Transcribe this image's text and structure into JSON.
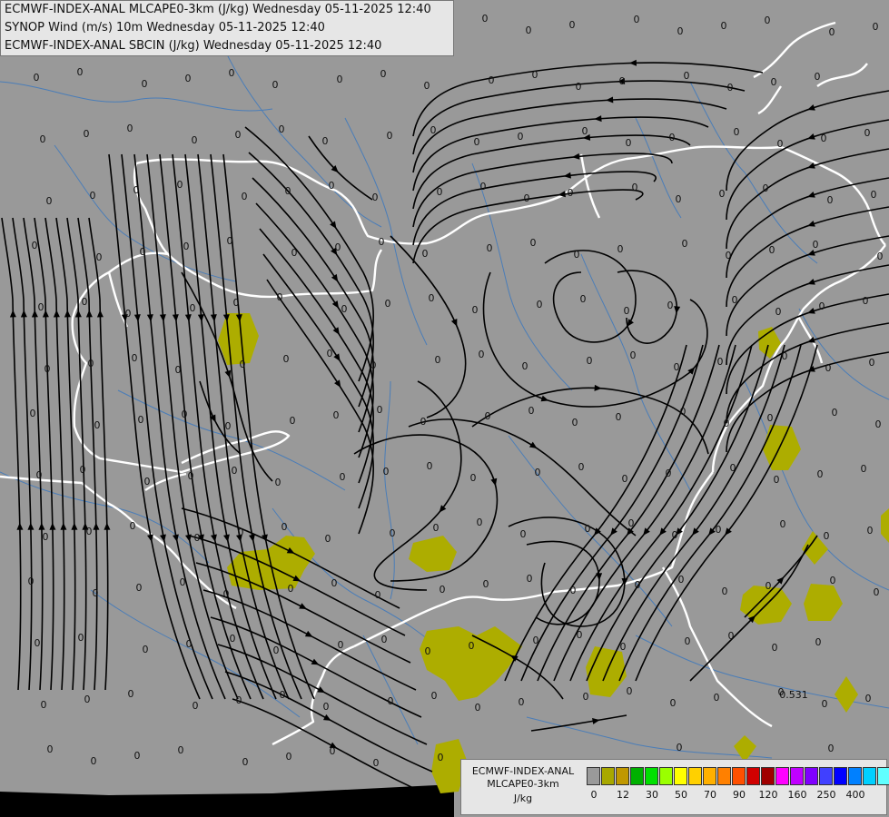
{
  "header": {
    "line1": "ECMWF-INDEX-ANAL MLCAPE0-3km (J/kg) Wednesday 05-11-2025 12:40",
    "line2": "SYNOP Wind (m/s) 10m Wednesday 05-11-2025 12:40",
    "line3": "ECMWF-INDEX-ANAL SBCIN (J/kg) Wednesday 05-11-2025 12:40"
  },
  "legend": {
    "line1": "ECMWF-INDEX-ANAL",
    "line2": "MLCAPE0-3km",
    "unit": "J/kg",
    "colors": [
      "#9a9a9a",
      "#a8a800",
      "#c09800",
      "#00b000",
      "#00e000",
      "#9aff00",
      "#ffff00",
      "#ffd000",
      "#ffb000",
      "#ff8000",
      "#ff5000",
      "#d00000",
      "#a00000",
      "#ff00ff",
      "#c000ff",
      "#8000ff",
      "#4040ff",
      "#0000ff",
      "#0080ff",
      "#00d0ff",
      "#60ffff",
      "#b0ffff",
      "#ffffff"
    ],
    "ticks": [
      "0",
      "12",
      "30",
      "50",
      "70",
      "90",
      "120",
      "160",
      "250",
      "400"
    ],
    "tick_index": [
      1,
      3,
      5,
      7,
      9,
      11,
      13,
      15,
      17,
      19
    ]
  },
  "colors": {
    "background": "#999999",
    "cape_fill": "#adad00",
    "border": "#ffffff",
    "river": "#4a7db8",
    "streamline": "#000000"
  },
  "labels": {
    "zero": "0",
    "special": "0.531"
  }
}
